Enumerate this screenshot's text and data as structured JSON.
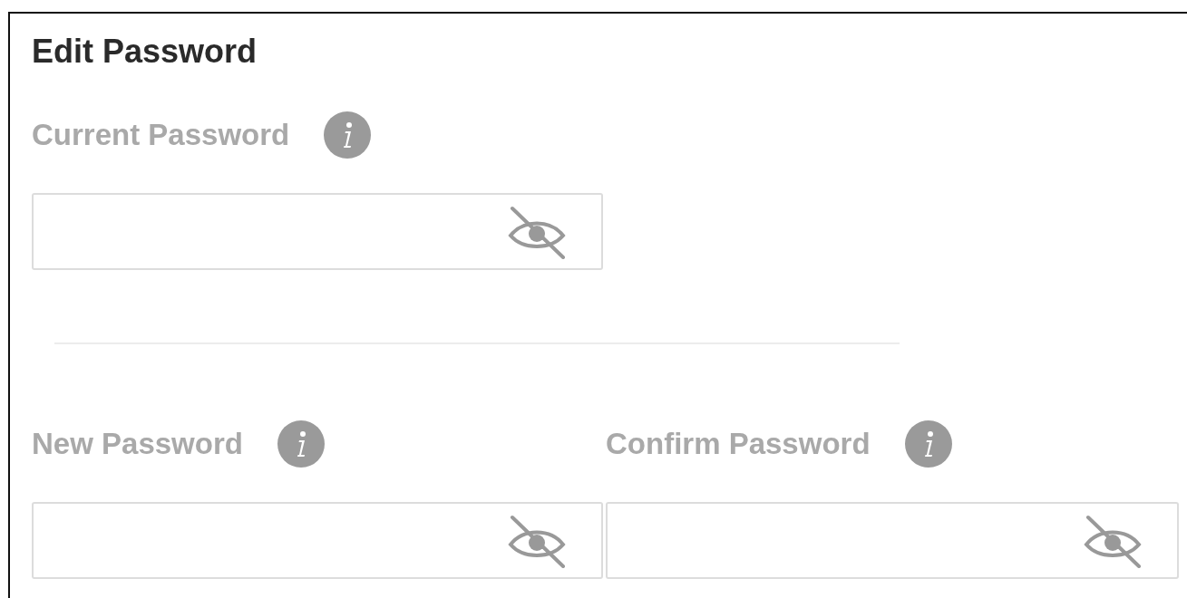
{
  "title": "Edit Password",
  "current": {
    "label": "Current Password",
    "show_password": false
  },
  "new_fields": [
    {
      "label": "New Password",
      "show_password": false
    },
    {
      "label": "Confirm Password",
      "show_password": false
    }
  ]
}
